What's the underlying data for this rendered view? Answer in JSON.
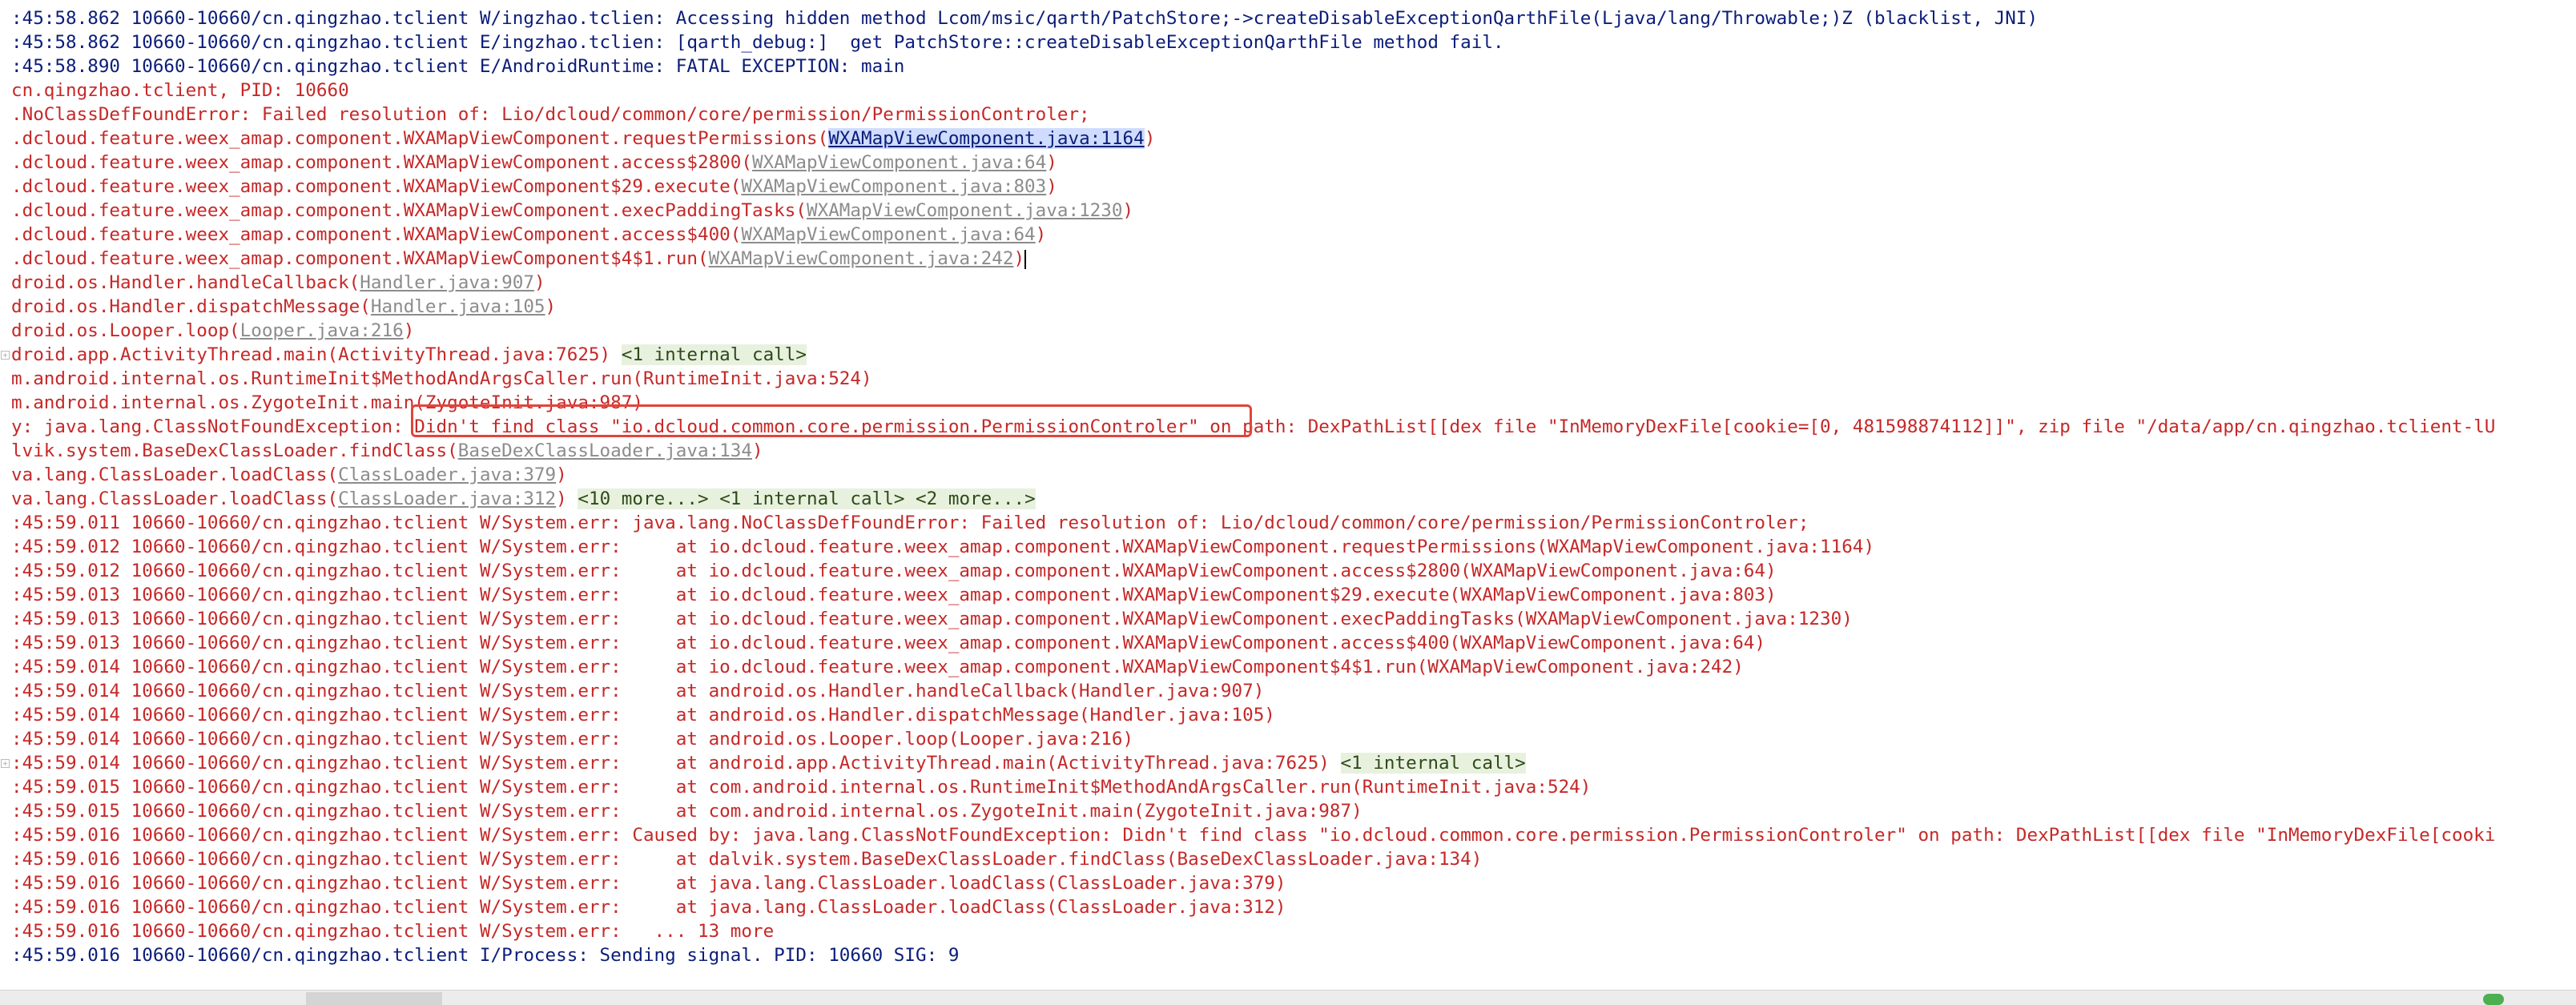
{
  "log": {
    "lines": [
      {
        "t": "info",
        "text": ":45:58.862 10660-10660/cn.qingzhao.tclient W/ingzhao.tclien: Accessing hidden method Lcom/msic/qarth/PatchStore;->createDisableExceptionQarthFile(Ljava/lang/Throwable;)Z (blacklist, JNI)"
      },
      {
        "t": "info",
        "text": ":45:58.862 10660-10660/cn.qingzhao.tclient E/ingzhao.tclien: [qarth_debug:]  get PatchStore::createDisableExceptionQarthFile method fail."
      },
      {
        "t": "info",
        "text": ":45:58.890 10660-10660/cn.qingzhao.tclient E/AndroidRuntime: FATAL EXCEPTION: main"
      },
      {
        "t": "err",
        "text": "cn.qingzhao.tclient, PID: 10660"
      },
      {
        "t": "err",
        "text": ".NoClassDefFoundError: Failed resolution of: Lio/dcloud/common/core/permission/PermissionControler;"
      },
      {
        "t": "err",
        "text": ".dcloud.feature.weex_amap.component.WXAMapViewComponent.requestPermissions(",
        "link": "WXAMapViewComponent.java:1164",
        "active": true,
        "after": ")"
      },
      {
        "t": "err",
        "text": ".dcloud.feature.weex_amap.component.WXAMapViewComponent.access$2800(",
        "link": "WXAMapViewComponent.java:64",
        "after": ")"
      },
      {
        "t": "err",
        "text": ".dcloud.feature.weex_amap.component.WXAMapViewComponent$29.execute(",
        "link": "WXAMapViewComponent.java:803",
        "after": ")"
      },
      {
        "t": "err",
        "text": ".dcloud.feature.weex_amap.component.WXAMapViewComponent.execPaddingTasks(",
        "link": "WXAMapViewComponent.java:1230",
        "after": ")"
      },
      {
        "t": "err",
        "text": ".dcloud.feature.weex_amap.component.WXAMapViewComponent.access$400(",
        "link": "WXAMapViewComponent.java:64",
        "after": ")"
      },
      {
        "t": "err",
        "text": ".dcloud.feature.weex_amap.component.WXAMapViewComponent$4$1.run(",
        "link": "WXAMapViewComponent.java:242",
        "after": ")",
        "caret": true
      },
      {
        "t": "err",
        "text": "droid.os.Handler.handleCallback(",
        "link": "Handler.java:907",
        "after": ")"
      },
      {
        "t": "err",
        "text": "droid.os.Handler.dispatchMessage(",
        "link": "Handler.java:105",
        "after": ")"
      },
      {
        "t": "err",
        "text": "droid.os.Looper.loop(",
        "link": "Looper.java:216",
        "after": ")"
      },
      {
        "t": "err",
        "text": "droid.app.ActivityThread.main(ActivityThread.java:7625) ",
        "badge": "<1 internal call>",
        "fold": true
      },
      {
        "t": "err",
        "text": "m.android.internal.os.RuntimeInit$MethodAndArgsCaller.run(RuntimeInit.java:524)"
      },
      {
        "t": "err",
        "text": "m.android.internal.os.ZygoteInit.main(ZygoteInit.java:987)"
      },
      {
        "t": "err",
        "text": "y: java.lang.ClassNotFoundException: Didn't find class \"io.dcloud.common.core.permission.PermissionControler\" on path: DexPathList[[dex file \"InMemoryDexFile[cookie=[0, 481598874112]]\", zip file \"/data/app/cn.qingzhao.tclient-lU"
      },
      {
        "t": "err",
        "text": "lvik.system.BaseDexClassLoader.findClass(",
        "link": "BaseDexClassLoader.java:134",
        "after": ")"
      },
      {
        "t": "err",
        "text": "va.lang.ClassLoader.loadClass(",
        "link": "ClassLoader.java:379",
        "after": ")"
      },
      {
        "t": "err",
        "text": "va.lang.ClassLoader.loadClass(",
        "link": "ClassLoader.java:312",
        "after": ") ",
        "badge": "<10 more...> <1 internal call> <2 more...>"
      },
      {
        "t": "err",
        "text": ":45:59.011 10660-10660/cn.qingzhao.tclient W/System.err: java.lang.NoClassDefFoundError: Failed resolution of: Lio/dcloud/common/core/permission/PermissionControler;"
      },
      {
        "t": "err",
        "text": ":45:59.012 10660-10660/cn.qingzhao.tclient W/System.err:     at io.dcloud.feature.weex_amap.component.WXAMapViewComponent.requestPermissions(WXAMapViewComponent.java:1164)"
      },
      {
        "t": "err",
        "text": ":45:59.012 10660-10660/cn.qingzhao.tclient W/System.err:     at io.dcloud.feature.weex_amap.component.WXAMapViewComponent.access$2800(WXAMapViewComponent.java:64)"
      },
      {
        "t": "err",
        "text": ":45:59.013 10660-10660/cn.qingzhao.tclient W/System.err:     at io.dcloud.feature.weex_amap.component.WXAMapViewComponent$29.execute(WXAMapViewComponent.java:803)"
      },
      {
        "t": "err",
        "text": ":45:59.013 10660-10660/cn.qingzhao.tclient W/System.err:     at io.dcloud.feature.weex_amap.component.WXAMapViewComponent.execPaddingTasks(WXAMapViewComponent.java:1230)"
      },
      {
        "t": "err",
        "text": ":45:59.013 10660-10660/cn.qingzhao.tclient W/System.err:     at io.dcloud.feature.weex_amap.component.WXAMapViewComponent.access$400(WXAMapViewComponent.java:64)"
      },
      {
        "t": "err",
        "text": ":45:59.014 10660-10660/cn.qingzhao.tclient W/System.err:     at io.dcloud.feature.weex_amap.component.WXAMapViewComponent$4$1.run(WXAMapViewComponent.java:242)"
      },
      {
        "t": "err",
        "text": ":45:59.014 10660-10660/cn.qingzhao.tclient W/System.err:     at android.os.Handler.handleCallback(Handler.java:907)"
      },
      {
        "t": "err",
        "text": ":45:59.014 10660-10660/cn.qingzhao.tclient W/System.err:     at android.os.Handler.dispatchMessage(Handler.java:105)"
      },
      {
        "t": "err",
        "text": ":45:59.014 10660-10660/cn.qingzhao.tclient W/System.err:     at android.os.Looper.loop(Looper.java:216)"
      },
      {
        "t": "err",
        "text": ":45:59.014 10660-10660/cn.qingzhao.tclient W/System.err:     at android.app.ActivityThread.main(ActivityThread.java:7625) ",
        "badge": "<1 internal call>",
        "fold": true
      },
      {
        "t": "err",
        "text": ":45:59.015 10660-10660/cn.qingzhao.tclient W/System.err:     at com.android.internal.os.RuntimeInit$MethodAndArgsCaller.run(RuntimeInit.java:524)"
      },
      {
        "t": "err",
        "text": ":45:59.015 10660-10660/cn.qingzhao.tclient W/System.err:     at com.android.internal.os.ZygoteInit.main(ZygoteInit.java:987)"
      },
      {
        "t": "err",
        "text": ":45:59.016 10660-10660/cn.qingzhao.tclient W/System.err: Caused by: java.lang.ClassNotFoundException: Didn't find class \"io.dcloud.common.core.permission.PermissionControler\" on path: DexPathList[[dex file \"InMemoryDexFile[cooki"
      },
      {
        "t": "err",
        "text": ":45:59.016 10660-10660/cn.qingzhao.tclient W/System.err:     at dalvik.system.BaseDexClassLoader.findClass(BaseDexClassLoader.java:134)"
      },
      {
        "t": "err",
        "text": ":45:59.016 10660-10660/cn.qingzhao.tclient W/System.err:     at java.lang.ClassLoader.loadClass(ClassLoader.java:379)"
      },
      {
        "t": "err",
        "text": ":45:59.016 10660-10660/cn.qingzhao.tclient W/System.err:     at java.lang.ClassLoader.loadClass(ClassLoader.java:312)"
      },
      {
        "t": "err",
        "text": ":45:59.016 10660-10660/cn.qingzhao.tclient W/System.err:   ... 13 more"
      },
      {
        "t": "info",
        "text": ":45:59.016 10660-10660/cn.qingzhao.tclient I/Process: Sending signal. PID: 10660 SIG: 9"
      }
    ]
  },
  "colors": {
    "info": "#0b1d7a",
    "error": "#c62828",
    "highlight_border": "#e0453a"
  }
}
